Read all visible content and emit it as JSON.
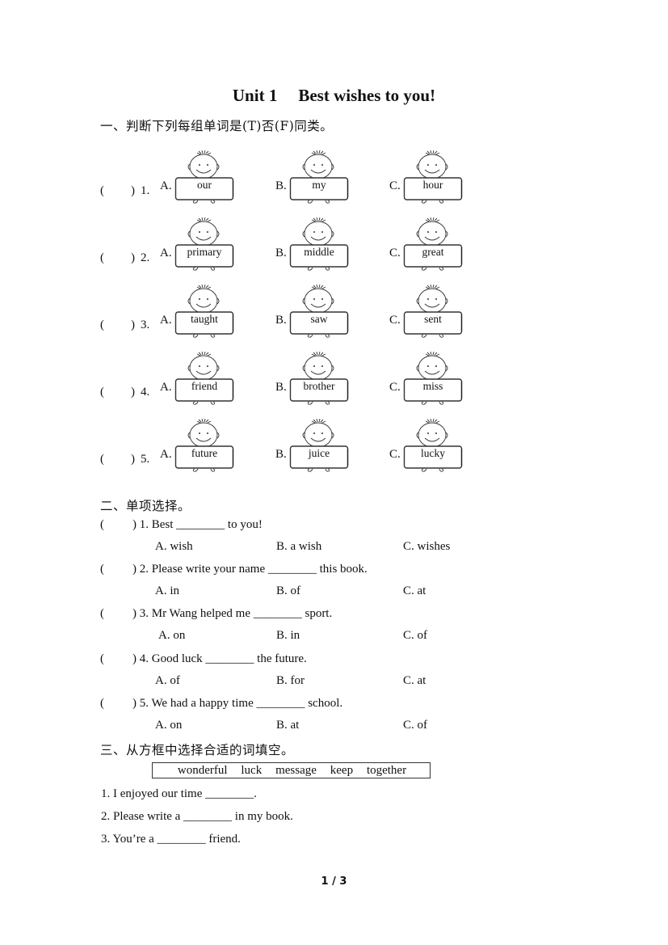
{
  "title": {
    "unit": "Unit 1",
    "name": "Best wishes to you!"
  },
  "section1": {
    "heading": "一、判断下列每组单词是(T)否(F)同类。",
    "paren": "(　　)",
    "icon": "cartoon-boy-holding-sign-icon",
    "questions": [
      {
        "num": "1.",
        "options": [
          {
            "letter": "A.",
            "word": "our"
          },
          {
            "letter": "B.",
            "word": "my"
          },
          {
            "letter": "C.",
            "word": "hour"
          }
        ]
      },
      {
        "num": "2.",
        "options": [
          {
            "letter": "A.",
            "word": "primary"
          },
          {
            "letter": "B.",
            "word": "middle"
          },
          {
            "letter": "C.",
            "word": "great"
          }
        ]
      },
      {
        "num": "3.",
        "options": [
          {
            "letter": "A.",
            "word": "taught"
          },
          {
            "letter": "B.",
            "word": "saw"
          },
          {
            "letter": "C.",
            "word": "sent"
          }
        ]
      },
      {
        "num": "4.",
        "options": [
          {
            "letter": "A.",
            "word": "friend"
          },
          {
            "letter": "B.",
            "word": "brother"
          },
          {
            "letter": "C.",
            "word": "miss"
          }
        ]
      },
      {
        "num": "5.",
        "options": [
          {
            "letter": "A.",
            "word": "future"
          },
          {
            "letter": "B.",
            "word": "juice"
          },
          {
            "letter": "C.",
            "word": "lucky"
          }
        ]
      }
    ]
  },
  "section2": {
    "heading": "二、单项选择。",
    "questions": [
      {
        "stem": ") 1. Best ________ to you!",
        "options": [
          "A. wish",
          "B. a wish",
          "C. wishes"
        ]
      },
      {
        "stem": ") 2. Please write your name ________ this book.",
        "options": [
          "A. in",
          "B. of",
          "C. at"
        ]
      },
      {
        "stem": ") 3. Mr Wang helped me ________ sport.",
        "options": [
          "A. on",
          "B. in",
          "C. of"
        ]
      },
      {
        "stem": ") 4. Good luck ________ the future.",
        "options": [
          "A. of",
          "B. for",
          "C. at"
        ]
      },
      {
        "stem": ") 5. We had a happy time ________ school.",
        "options": [
          "A. on",
          "B. at",
          "C. of"
        ]
      }
    ]
  },
  "section3": {
    "heading": "三、从方框中选择合适的词填空。",
    "word_bank": [
      "wonderful",
      "luck",
      "message",
      "keep",
      "together"
    ],
    "sentences": [
      "1. I enjoyed our time ________.",
      "2. Please write a ________ in my book.",
      "3. You’re a ________ friend."
    ]
  },
  "page_number": "1 / 3"
}
